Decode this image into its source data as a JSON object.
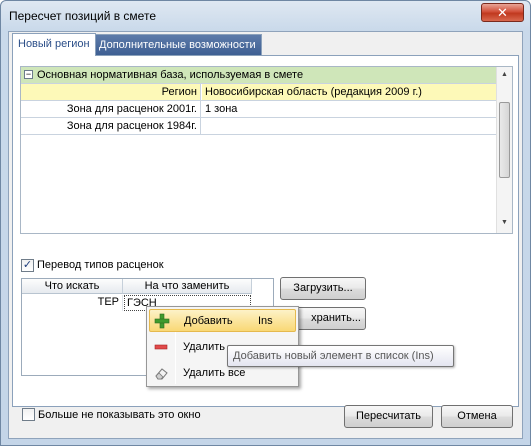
{
  "window": {
    "title": "Пересчет позиций в смете",
    "close_glyph": "✕"
  },
  "tabs": [
    {
      "label": "Новый регион",
      "active": true
    },
    {
      "label": "Дополнительные возможности",
      "active": false
    }
  ],
  "property_grid": {
    "group": {
      "toggle": "−",
      "label": "Основная нормативная база, используемая в смете"
    },
    "rows": [
      {
        "label": "Регион",
        "value": "Новосибирская область (редакция 2009 г.)",
        "highlight": true
      },
      {
        "label": "Зона для расценок 2001г.",
        "value": "1 зона"
      },
      {
        "label": "Зона для расценок 1984г.",
        "value": ""
      }
    ],
    "scroll_up": "▲",
    "scroll_down": "▼"
  },
  "price_type_conversion": {
    "label": "Перевод типов расценок",
    "checked": true,
    "check_glyph": "✓"
  },
  "mapping_table": {
    "columns": [
      "Что искать",
      "На что заменить"
    ],
    "rows": [
      {
        "find": "ТЕР",
        "replace": "ГЭСН"
      }
    ]
  },
  "buttons": {
    "load": "Загрузить...",
    "save": "хранить...",
    "recalculate": "Пересчитать",
    "cancel": "Отмена"
  },
  "context_menu": {
    "items": [
      {
        "label": "Добавить",
        "shortcut": "Ins",
        "icon": "plus-icon",
        "highlighted": true
      },
      {
        "label": "Удалить",
        "shortcut": "",
        "icon": "minus-icon",
        "highlighted": false
      },
      {
        "label": "Удалить все",
        "shortcut": "",
        "icon": "eraser-icon",
        "highlighted": false
      }
    ]
  },
  "tooltip": {
    "text": "Добавить новый элемент в список (Ins)"
  },
  "dont_show": {
    "label": "Больше не показывать это окно",
    "checked": false
  },
  "colors": {
    "accent_tab": "#3e5f93",
    "group_header": "#cfe6b9",
    "highlight_row": "#fdf9b8",
    "close_button": "#c0391f"
  }
}
